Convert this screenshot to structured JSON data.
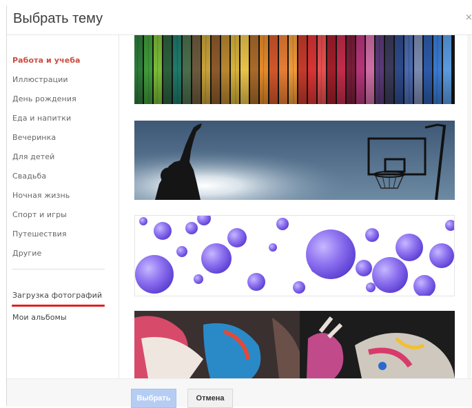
{
  "dialog": {
    "title": "Выбрать тему",
    "close_icon": "close-icon"
  },
  "sidebar": {
    "categories": [
      {
        "label": "Работа и учеба",
        "active": true
      },
      {
        "label": "Иллюстрации"
      },
      {
        "label": "День рождения"
      },
      {
        "label": "Еда и напитки"
      },
      {
        "label": "Вечеринка"
      },
      {
        "label": "Для детей"
      },
      {
        "label": "Свадьба"
      },
      {
        "label": "Ночная жизнь"
      },
      {
        "label": "Спорт и игры"
      },
      {
        "label": "Путешествия"
      },
      {
        "label": "Другие"
      }
    ],
    "upload_label": "Загрузка фотографий",
    "albums_label": "Мои альбомы"
  },
  "themes": [
    {
      "name": "colored-yarn-theme"
    },
    {
      "name": "basketball-theme"
    },
    {
      "name": "purple-bubbles-theme"
    },
    {
      "name": "painted-hands-theme"
    }
  ],
  "footer": {
    "select_label": "Выбрать",
    "cancel_label": "Отмена"
  },
  "colors": {
    "accent_active": "#cc4b3c",
    "select_button": "#b6cdf3",
    "underline": "#e02020"
  }
}
